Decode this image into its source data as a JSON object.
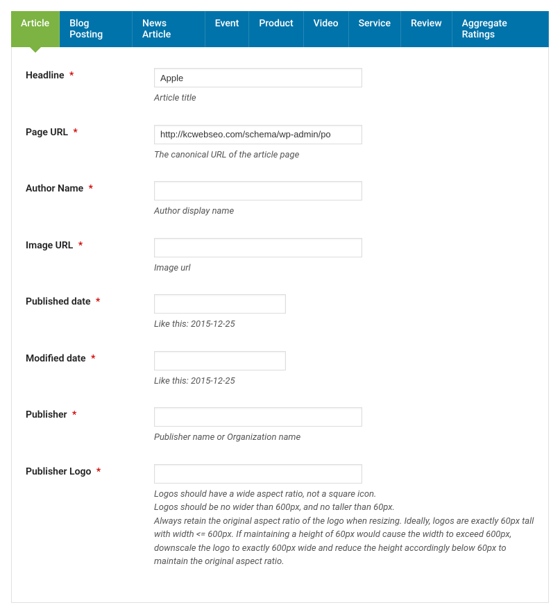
{
  "tabs": [
    {
      "label": "Article",
      "active": true
    },
    {
      "label": "Blog Posting",
      "active": false
    },
    {
      "label": "News Article",
      "active": false
    },
    {
      "label": "Event",
      "active": false
    },
    {
      "label": "Product",
      "active": false
    },
    {
      "label": "Video",
      "active": false
    },
    {
      "label": "Service",
      "active": false
    },
    {
      "label": "Review",
      "active": false
    },
    {
      "label": "Aggregate Ratings",
      "active": false
    }
  ],
  "fields": {
    "headline": {
      "label": "Headline",
      "value": "Apple",
      "help": "Article title"
    },
    "page_url": {
      "label": "Page URL",
      "value": "http://kcwebseo.com/schema/wp-admin/po",
      "help": "The canonical URL of the article page"
    },
    "author_name": {
      "label": "Author Name",
      "value": "",
      "help": "Author display name"
    },
    "image_url": {
      "label": "Image URL",
      "value": "",
      "help": "Image url"
    },
    "published_date": {
      "label": "Published date",
      "value": "",
      "help": "Like this: 2015-12-25"
    },
    "modified_date": {
      "label": "Modified date",
      "value": "",
      "help": "Like this: 2015-12-25"
    },
    "publisher": {
      "label": "Publisher",
      "value": "",
      "help": "Publisher name or Organization name"
    },
    "publisher_logo": {
      "label": "Publisher Logo",
      "value": "",
      "help_lines": [
        "Logos should have a wide aspect ratio, not a square icon.",
        "Logos should be no wider than 600px, and no taller than 60px.",
        "Always retain the original aspect ratio of the logo when resizing. Ideally, logos are exactly 60px tall with width <= 600px. If maintaining a height of 60px would cause the width to exceed 600px, downscale the logo to exactly 600px wide and reduce the height accordingly below 60px to maintain the original aspect ratio."
      ]
    }
  },
  "required_mark": "*"
}
